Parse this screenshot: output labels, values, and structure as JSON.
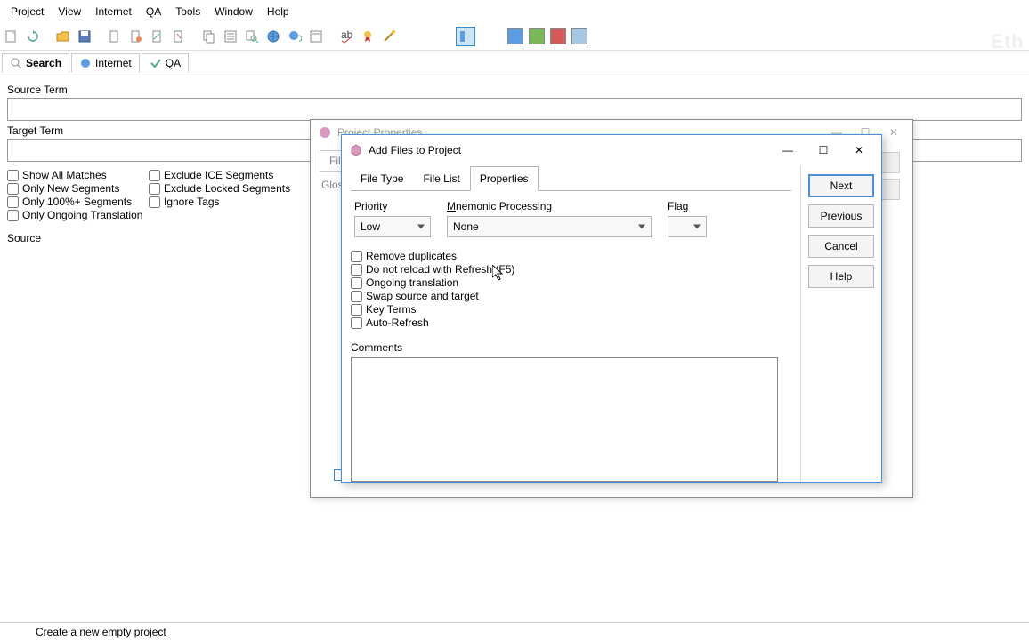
{
  "menubar": [
    "Project",
    "View",
    "Internet",
    "QA",
    "Tools",
    "Window",
    "Help"
  ],
  "subtabs": {
    "search": "Search",
    "internet": "Internet",
    "qa": "QA"
  },
  "left": {
    "source_term": "Source Term",
    "target_term": "Target Term",
    "source": "Source",
    "checks": {
      "show_all": "Show All Matches",
      "exclude_ice": "Exclude ICE Segments",
      "only_new": "Only New Segments",
      "exclude_locked": "Exclude Locked Segments",
      "only_100plus": "Only 100%+ Segments",
      "ignore_tags": "Ignore Tags",
      "only_ongoing": "Only Ongoing Translation"
    }
  },
  "bg_dialog": {
    "title": "Project Properties",
    "tab": "Files",
    "gloss": "Glos",
    "buttons": {
      "b1": " ",
      "b2": " "
    }
  },
  "dialog": {
    "title": "Add Files to Project",
    "tabs": {
      "filetype": "File Type",
      "filelist": "File List",
      "properties": "Properties"
    },
    "priority_label": "Priority",
    "priority_value": "Low",
    "mnemonic_label": "Mnemonic Processing",
    "mnemonic_value": "None",
    "flag_label": "Flag",
    "checks": {
      "remove_dup": "Remove duplicates",
      "no_reload": "Do not reload with Refresh (F5)",
      "ongoing": "Ongoing translation",
      "swap": "Swap source and target",
      "key_terms": "Key Terms",
      "auto_refresh": "Auto-Refresh"
    },
    "comments_label": "Comments",
    "buttons": {
      "next": "Next",
      "previous": "Previous",
      "cancel": "Cancel",
      "help": "Help"
    }
  },
  "statusbar": "Create a new empty project",
  "watermark": "Eth"
}
